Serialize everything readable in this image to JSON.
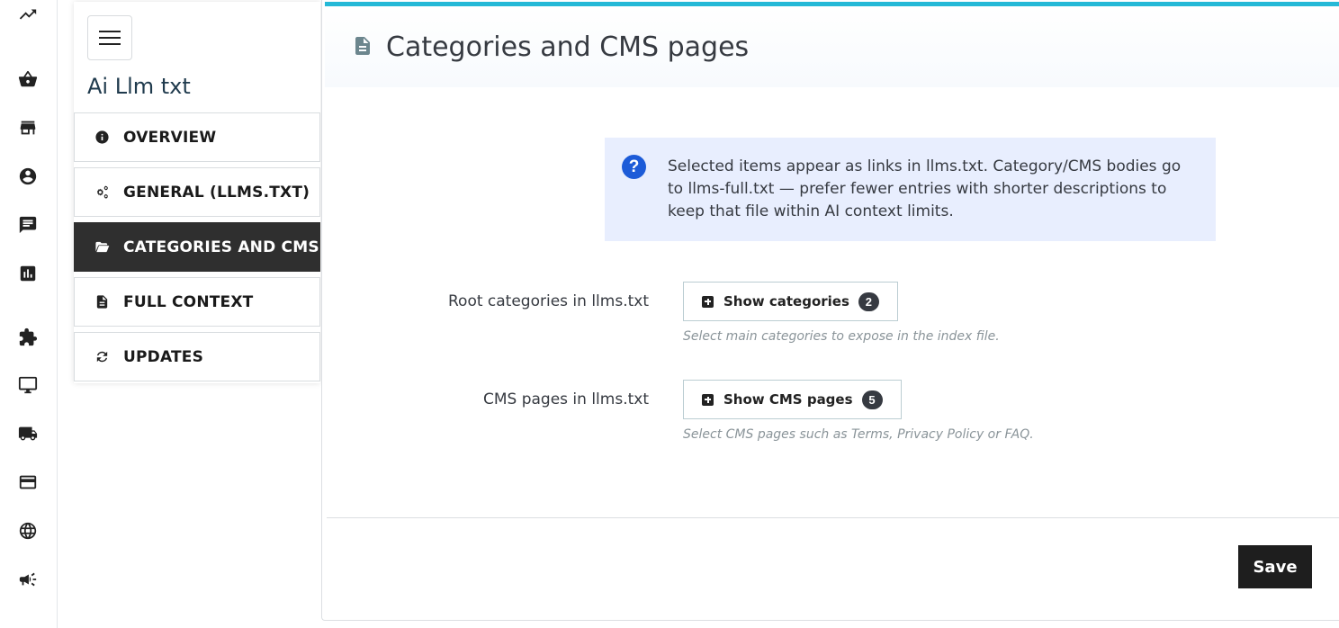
{
  "rail": {
    "icons": [
      "trending-up-icon",
      "basket-icon",
      "store-icon",
      "account-icon",
      "message-icon",
      "stats-icon",
      "puzzle-icon",
      "monitor-icon",
      "truck-icon",
      "credit-card-icon",
      "globe-icon",
      "megaphone-icon"
    ]
  },
  "panel": {
    "title": "Ai Llm txt",
    "nav": [
      {
        "label": "OVERVIEW",
        "icon": "info-icon"
      },
      {
        "label": "GENERAL (LLMS.TXT)",
        "icon": "gears-icon"
      },
      {
        "label": "CATEGORIES AND CMS",
        "icon": "folder-open-icon",
        "active": true
      },
      {
        "label": "FULL CONTEXT",
        "icon": "file-text-icon"
      },
      {
        "label": "UPDATES",
        "icon": "refresh-icon"
      }
    ]
  },
  "main": {
    "title": "Categories and CMS pages",
    "title_icon": "file-text-icon",
    "info_text": "Selected items appear as links in llms.txt. Category/CMS bodies go to llms-full.txt — prefer fewer entries with shorter descriptions to keep that file within AI context limits.",
    "rows": [
      {
        "label": "Root categories in llms.txt",
        "button": "Show categories",
        "badge": "2",
        "help": "Select main categories to expose in the index file."
      },
      {
        "label": "CMS pages in llms.txt",
        "button": "Show CMS pages",
        "badge": "5",
        "help": "Select CMS pages such as Terms, Privacy Policy or FAQ."
      }
    ],
    "save_label": "Save"
  },
  "colors": {
    "accent": "#25b9d7",
    "info_bg": "#e8eefe",
    "question_icon": "#1c5bd8",
    "active_nav": "#2f2f2f",
    "save_button": "#1e1e1e"
  }
}
